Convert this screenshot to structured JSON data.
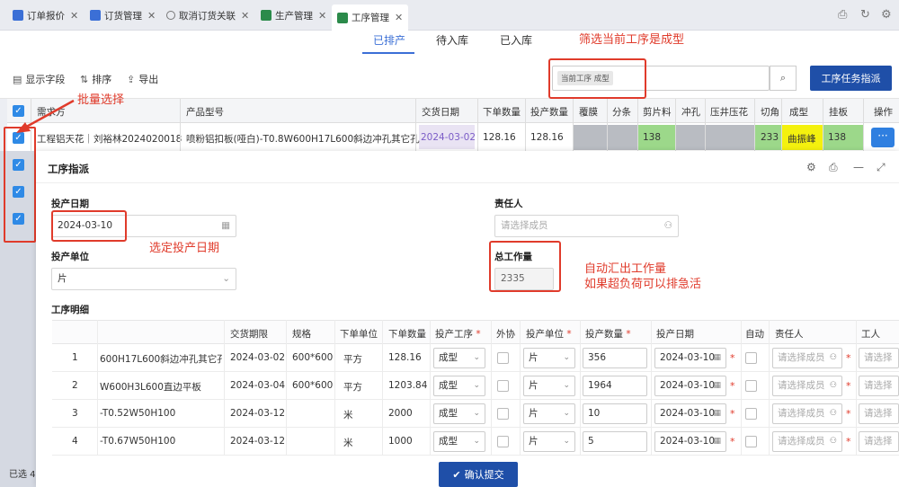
{
  "tabs": [
    {
      "label": "订单报价",
      "icon": "document-icon"
    },
    {
      "label": "订货管理",
      "icon": "document-icon"
    },
    {
      "label": "取消订货关联",
      "icon": "gear-icon"
    },
    {
      "label": "生产管理",
      "icon": "spreadsheet-icon"
    },
    {
      "label": "工序管理",
      "icon": "spreadsheet-icon",
      "active": true
    }
  ],
  "subtabs": [
    "已排产",
    "待入库",
    "已入库"
  ],
  "toolbar": {
    "show_fields": "显示字段",
    "sort": "排序",
    "export": "导出"
  },
  "filter": {
    "chip": "当前工序 成型",
    "assign_button": "工序任务指派"
  },
  "grid": {
    "headers": [
      "需求方",
      "产品型号",
      "交货日期",
      "下单数量",
      "投产数量",
      "覆膜",
      "分条",
      "剪片料",
      "冲孔",
      "压井压花",
      "切角",
      "成型",
      "挂板",
      "操作"
    ],
    "row": {
      "customer": "工程铝天花｜刘裕林2024020018",
      "model": "喷粉铝扣板(哑白)-T0.8W600H17L600斜边冲孔其它孔",
      "delivery": "2024-03-02",
      "order_qty": "128.16",
      "prod_qty": "128.16",
      "cut": "138",
      "corner": "233",
      "forming": "曲振峰",
      "hang": "138",
      "op": "···"
    }
  },
  "bottom_selected": "已选 4",
  "dialog": {
    "title": "工序指派",
    "start_date_label": "投产日期",
    "start_date": "2024-03-10",
    "owner_label": "责任人",
    "owner_placeholder": "请选择成员",
    "unit_label": "投产单位",
    "unit": "片",
    "total_label": "总工作量",
    "total": "2335",
    "detail_label": "工序明细",
    "detail_headers": [
      "交货期限",
      "规格",
      "下单单位",
      "下单数量",
      "投产工序",
      "外协",
      "投产单位",
      "投产数量",
      "投产日期",
      "自动",
      "责任人",
      "工人"
    ],
    "rows": [
      {
        "no": "1",
        "name": "600H17L600斜边冲孔其它孔",
        "deadline": "2024-03-02",
        "spec": "600*600",
        "unit": "平方",
        "qty": "128.16",
        "process": "成型",
        "punit": "片",
        "pqty": "356",
        "pdate": "2024-03-10",
        "owner": "请选择成员",
        "worker": "请选择成"
      },
      {
        "no": "2",
        "name": "W600H3L600直边平板",
        "deadline": "2024-03-04",
        "spec": "600*600",
        "unit": "平方",
        "qty": "1203.84",
        "process": "成型",
        "punit": "片",
        "pqty": "1964",
        "pdate": "2024-03-10",
        "owner": "请选择成员",
        "worker": "请选择成"
      },
      {
        "no": "3",
        "name": "-T0.52W50H100",
        "deadline": "2024-03-12",
        "spec": "",
        "unit": "米",
        "qty": "2000",
        "process": "成型",
        "punit": "片",
        "pqty": "10",
        "pdate": "2024-03-10",
        "owner": "请选择成员",
        "worker": "请选择成"
      },
      {
        "no": "4",
        "name": "-T0.67W50H100",
        "deadline": "2024-03-12",
        "spec": "",
        "unit": "米",
        "qty": "1000",
        "process": "成型",
        "punit": "片",
        "pqty": "5",
        "pdate": "2024-03-10",
        "owner": "请选择成员",
        "worker": "请选择成"
      }
    ],
    "submit": "确认提交"
  },
  "annotations": {
    "filter_note": "筛选当前工序是成型",
    "batch_note": "批量选择",
    "date_note": "选定投产日期",
    "total_note_1": "自动汇出工作量",
    "total_note_2": "如果超负荷可以排急活"
  },
  "colors": {
    "accent": "#3b6fd6",
    "primary_button": "#1f4fa8",
    "annotation": "#e03b2b",
    "green_cell": "#9cd88a",
    "yellow_cell": "#f4f10e"
  }
}
